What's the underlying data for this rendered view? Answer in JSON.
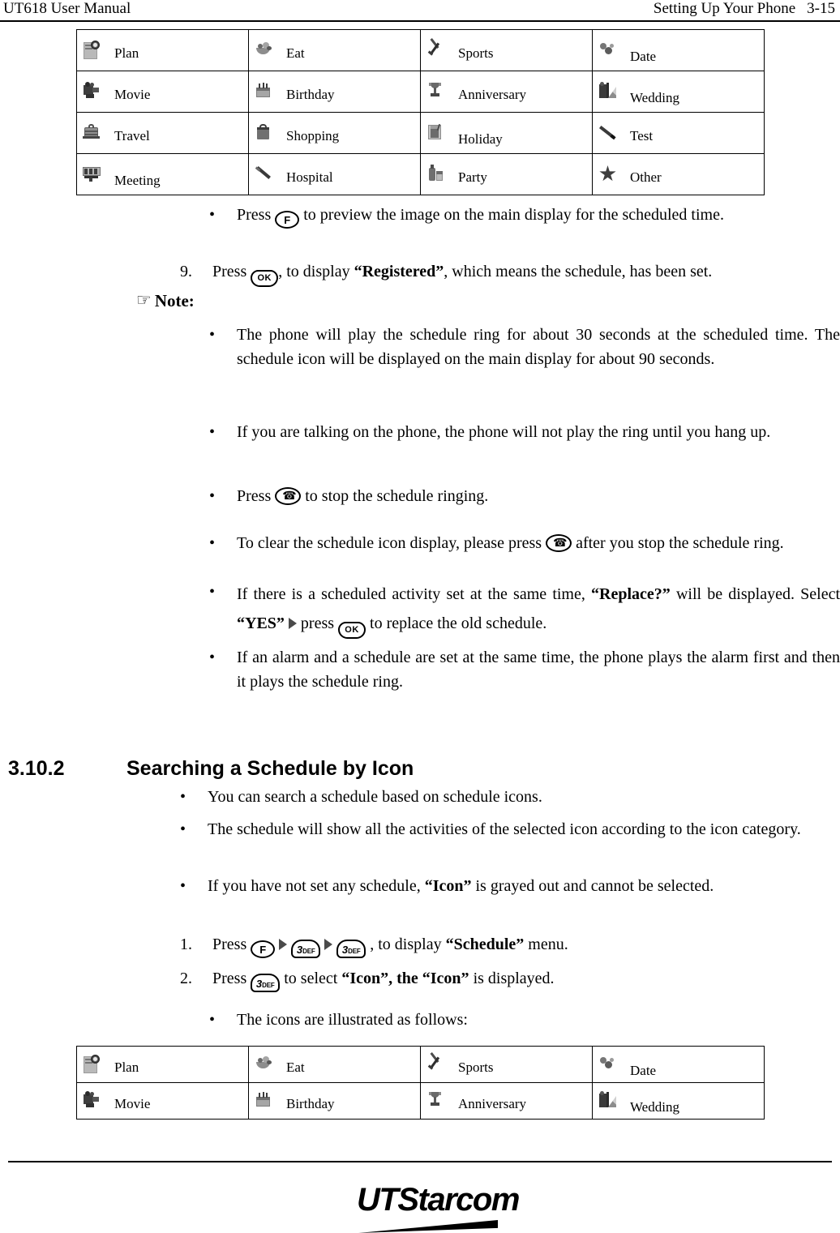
{
  "header": {
    "left": "UT618 User Manual",
    "right_title": "Setting Up Your Phone",
    "page_number": "3-15"
  },
  "icon_table_top": {
    "rows": [
      [
        {
          "icon": "plan-icon",
          "label": "Plan"
        },
        {
          "icon": "eat-icon",
          "label": "Eat"
        },
        {
          "icon": "sports-icon",
          "label": "Sports"
        },
        {
          "icon": "date-icon",
          "label": "Date"
        }
      ],
      [
        {
          "icon": "movie-icon",
          "label": "Movie"
        },
        {
          "icon": "birthday-icon",
          "label": "Birthday"
        },
        {
          "icon": "anniversary-icon",
          "label": "Anniversary"
        },
        {
          "icon": "wedding-icon",
          "label": "Wedding"
        }
      ],
      [
        {
          "icon": "travel-icon",
          "label": "Travel"
        },
        {
          "icon": "shopping-icon",
          "label": "Shopping"
        },
        {
          "icon": "holiday-icon",
          "label": "Holiday"
        },
        {
          "icon": "test-icon",
          "label": "Test"
        }
      ],
      [
        {
          "icon": "meeting-icon",
          "label": "Meeting"
        },
        {
          "icon": "hospital-icon",
          "label": "Hospital"
        },
        {
          "icon": "party-icon",
          "label": "Party"
        },
        {
          "icon": "other-icon",
          "label": "Other"
        }
      ]
    ]
  },
  "icon_table_bottom": {
    "rows": [
      [
        {
          "icon": "plan-icon",
          "label": "Plan"
        },
        {
          "icon": "eat-icon",
          "label": "Eat"
        },
        {
          "icon": "sports-icon",
          "label": "Sports"
        },
        {
          "icon": "date-icon",
          "label": "Date"
        }
      ],
      [
        {
          "icon": "movie-icon",
          "label": "Movie"
        },
        {
          "icon": "birthday-icon",
          "label": "Birthday"
        },
        {
          "icon": "anniversary-icon",
          "label": "Anniversary"
        },
        {
          "icon": "wedding-icon",
          "label": "Wedding"
        }
      ]
    ]
  },
  "keys": {
    "f": "F",
    "ok": "OK",
    "three_digit": "3",
    "three_letters": "DEF"
  },
  "body": {
    "preview_bullet_pre": "Press",
    "preview_bullet_post": "to preview the image on the main display for the scheduled time.",
    "step9_num": "9.",
    "step9_pre": "Press",
    "step9_mid": ", to display",
    "step9_bold": "“Registered”",
    "step9_post": ", which means the schedule, has been set.",
    "note_hand": "☞",
    "note_label": "Note:",
    "note_1": "The phone will play the schedule ring for about 30 seconds at the scheduled time. The schedule icon will be displayed on the main display for about 90 seconds.",
    "note_2": "If you are talking on the phone, the phone will not play the ring until you hang up.",
    "note_3_pre": "Press",
    "note_3_post": "to stop the schedule ringing.",
    "note_4_pre": "To clear the schedule icon display, please press",
    "note_4_post": "after you stop the schedule ring.",
    "note_5_pre": "If there is a scheduled activity set at the same time,",
    "note_5_bold1": "“Replace?”",
    "note_5_mid": "will be displayed. Select",
    "note_5_bold2": "“YES”",
    "note_5_mid2": "press",
    "note_5_post": "to replace the old schedule.",
    "note_6": "If an alarm and a schedule are set at the same time, the phone plays the alarm first and then it plays the schedule ring."
  },
  "section": {
    "number": "3.10.2",
    "title": "Searching a Schedule by Icon",
    "bullet_1": "You can search a schedule based on schedule icons.",
    "bullet_2": "The schedule will show all the activities of the selected icon according to the icon category.",
    "bullet_3_pre": "If you have not set any schedule,",
    "bullet_3_bold": "“Icon”",
    "bullet_3_post": "is grayed out and cannot be selected.",
    "step1_num": "1.",
    "step1_pre": "Press",
    "step1_mid": ", to display",
    "step1_bold": "“Schedule”",
    "step1_post": "menu.",
    "step2_num": "2.",
    "step2_pre": "Press",
    "step2_mid": "to select",
    "step2_bold": "“Icon”, the “Icon”",
    "step2_post": "is displayed.",
    "bullet_4": "The icons are illustrated as follows:"
  },
  "footer": {
    "logo_ut": "UT",
    "logo_rest": "Starcom"
  }
}
